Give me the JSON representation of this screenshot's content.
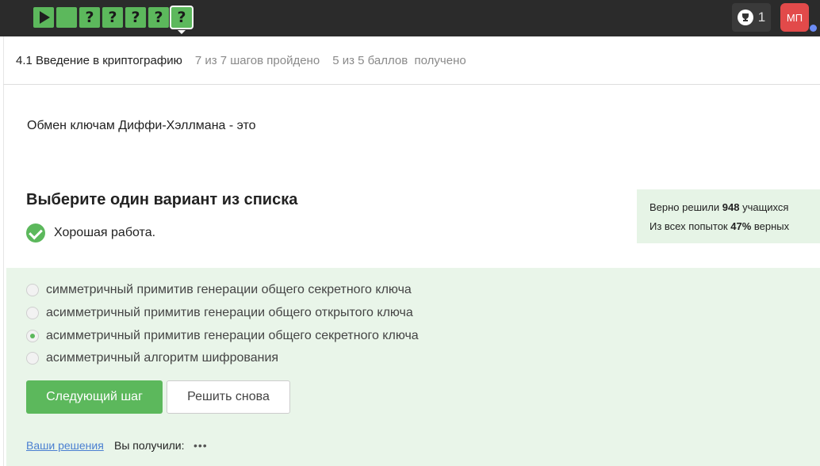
{
  "steps": [
    {
      "type": "play",
      "label": ""
    },
    {
      "type": "blank",
      "label": ""
    },
    {
      "type": "question",
      "label": "?"
    },
    {
      "type": "question",
      "label": "?"
    },
    {
      "type": "question",
      "label": "?"
    },
    {
      "type": "question",
      "label": "?"
    },
    {
      "type": "question",
      "label": "?",
      "active": true
    }
  ],
  "topbar": {
    "trophy_count": "1",
    "avatar_initials": "МП"
  },
  "lesson": {
    "title": "4.1 Введение в криптографию",
    "steps_done": "7 из 7 шагов пройдено",
    "points": "5 из 5 баллов  получено"
  },
  "question": {
    "text": "Обмен ключам Диффи-Хэллмана - это",
    "subtitle": "Выберите один вариант из списка",
    "feedback": "Хорошая работа."
  },
  "stats": {
    "solved_prefix": "Верно решили ",
    "solved_count": "948",
    "solved_suffix": " учащихся",
    "attempts_prefix": "Из всех попыток ",
    "attempts_pct": "47%",
    "attempts_suffix": " верных"
  },
  "options": [
    {
      "label": "симметричный примитив генерации общего секретного ключа",
      "checked": false
    },
    {
      "label": "асимметричный примитив генерации общего открытого ключа",
      "checked": false
    },
    {
      "label": "асимметричный примитив генерации общего секретного ключа",
      "checked": true
    },
    {
      "label": "асимметричный алгоритм шифрования",
      "checked": false
    }
  ],
  "actions": {
    "next_label": "Следующий шаг",
    "retry_label": "Решить снова",
    "solutions_link": "Ваши решения",
    "got_label": "Вы получили:",
    "more": "•••"
  },
  "colors": {
    "accent": "#5cb85c",
    "topbar": "#2b2b2b",
    "answers_bg": "#e9f5e9",
    "avatar": "#e24a4a",
    "link": "#4a7fd1"
  }
}
